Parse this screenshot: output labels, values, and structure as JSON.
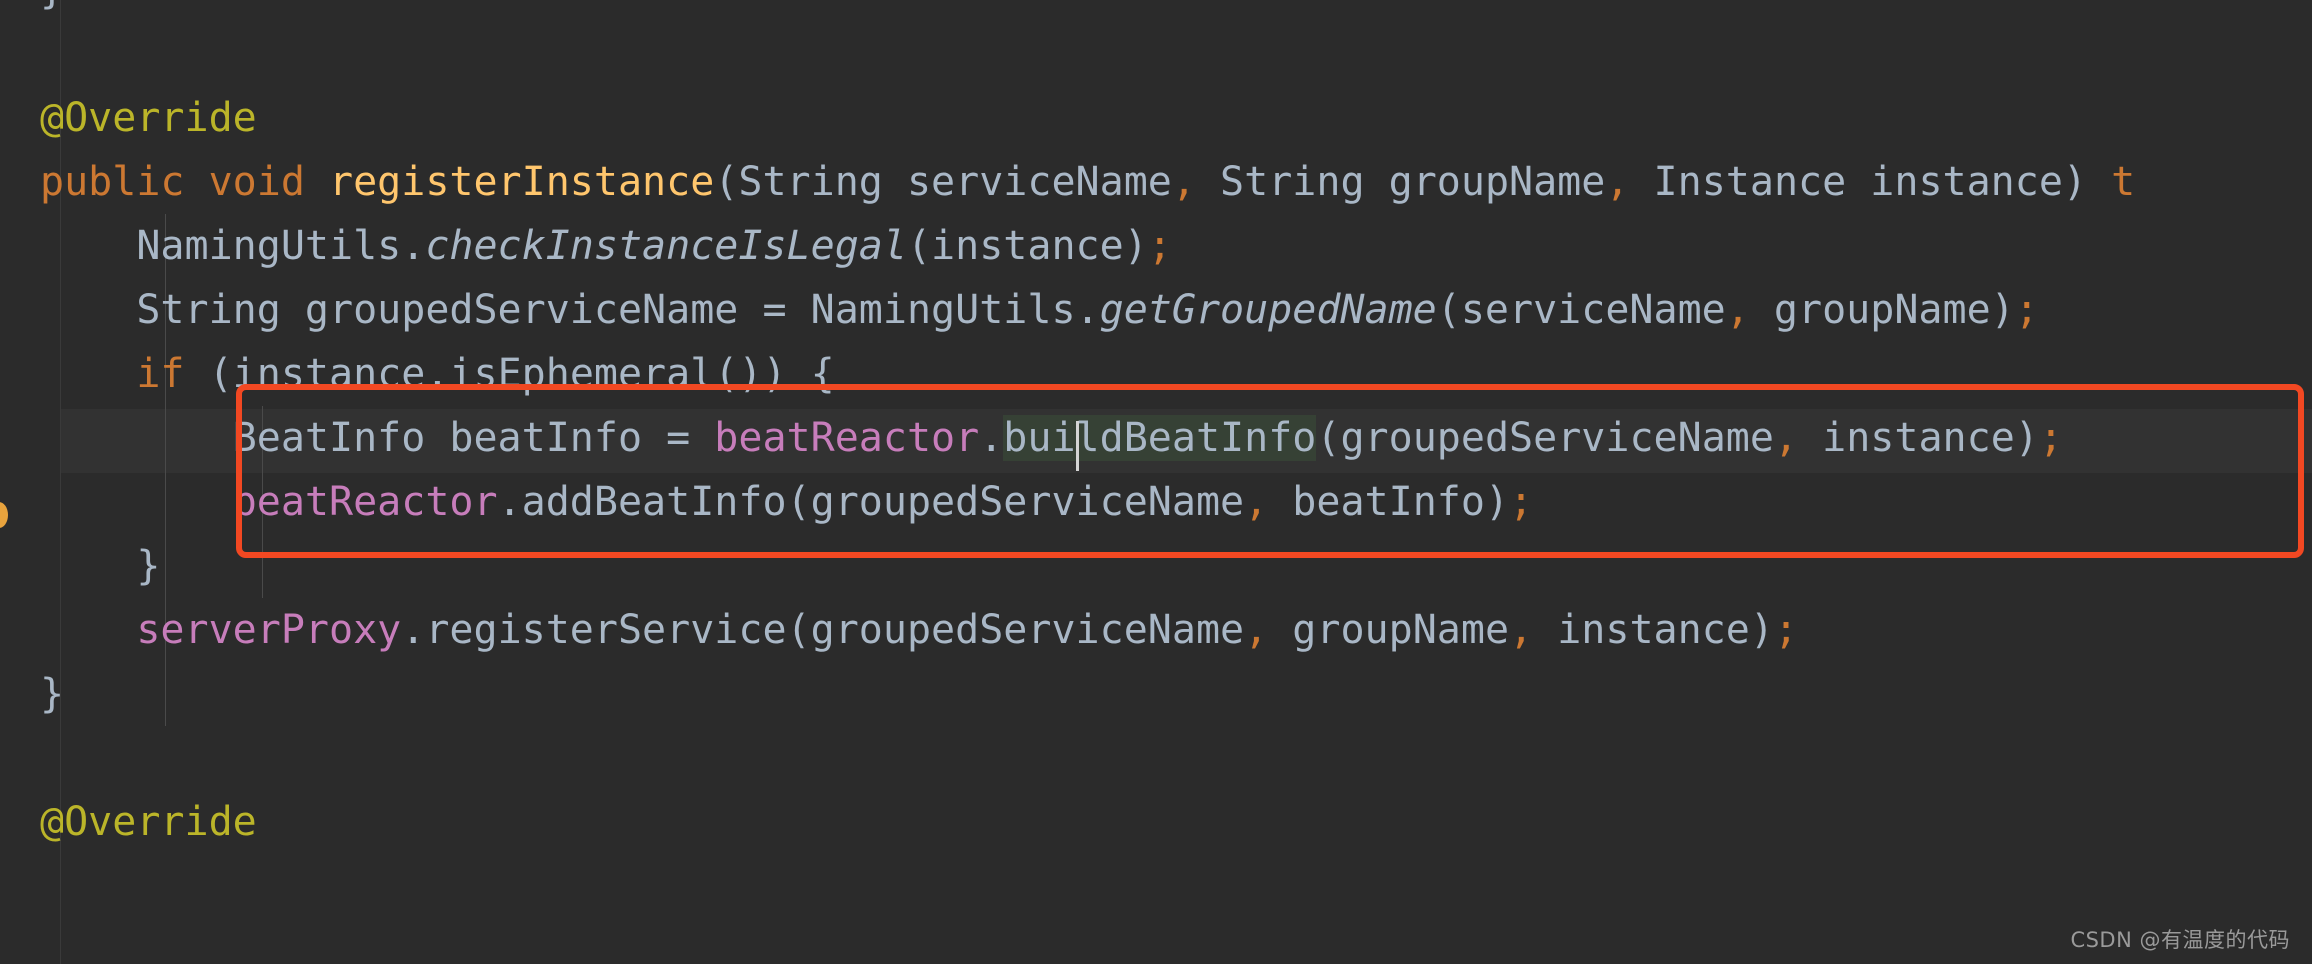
{
  "editor": {
    "theme_name": "darcula",
    "colors": {
      "background": "#2b2b2b",
      "current_line_background": "#323232",
      "gutter_separator": "#3a3a3a",
      "indent_guide": "#4a4a4a",
      "default_text": "#a9b7c6",
      "keyword": "#cc7832",
      "method_declaration": "#ffc66d",
      "field": "#c77dbb",
      "annotation": "#bbb529",
      "identifier_highlight": "#364135",
      "caret": "#d4d4d4",
      "annotation_box": "#f24822",
      "gutter_marker": "#e8a33d",
      "watermark": "#9a9a9a"
    },
    "caret": {
      "line_number": 6,
      "column_label": "bui|ldBeatInfo"
    },
    "highlighted_identifier": "buildBeatInfo"
  },
  "code_lines": [
    {
      "id": "line-1",
      "text": "}",
      "indent": 0,
      "tokens": [
        {
          "kind": "brace",
          "text": "}"
        }
      ]
    },
    {
      "id": "line-2",
      "text": "",
      "indent": 0,
      "tokens": []
    },
    {
      "id": "line-3",
      "text": "@Override",
      "indent": 0,
      "tokens": [
        {
          "kind": "annotation",
          "text": "@Override"
        }
      ]
    },
    {
      "id": "line-4",
      "text": "public void registerInstance(String serviceName, String groupName, Instance instance) t",
      "indent": 0,
      "tokens": [
        {
          "kind": "keyword",
          "text": "public void "
        },
        {
          "kind": "method",
          "text": "registerInstance"
        },
        {
          "kind": "default",
          "text": "(String serviceName"
        },
        {
          "kind": "comma",
          "text": ","
        },
        {
          "kind": "default",
          "text": " String groupName"
        },
        {
          "kind": "comma",
          "text": ","
        },
        {
          "kind": "default",
          "text": " Instance instance) "
        },
        {
          "kind": "keyword",
          "text": "t"
        }
      ]
    },
    {
      "id": "line-5",
      "text": "    NamingUtils.checkInstanceIsLegal(instance);",
      "indent": 1,
      "tokens": [
        {
          "kind": "default",
          "text": "    NamingUtils."
        },
        {
          "kind": "static",
          "text": "checkInstanceIsLegal"
        },
        {
          "kind": "default",
          "text": "(instance)"
        },
        {
          "kind": "semi",
          "text": ";"
        }
      ]
    },
    {
      "id": "line-6",
      "text": "    String groupedServiceName = NamingUtils.getGroupedName(serviceName, groupName);",
      "indent": 1,
      "tokens": [
        {
          "kind": "default",
          "text": "    String groupedServiceName = NamingUtils."
        },
        {
          "kind": "static",
          "text": "getGroupedName"
        },
        {
          "kind": "default",
          "text": "(serviceName"
        },
        {
          "kind": "comma",
          "text": ","
        },
        {
          "kind": "default",
          "text": " groupName)"
        },
        {
          "kind": "semi",
          "text": ";"
        }
      ]
    },
    {
      "id": "line-7",
      "text": "    if (instance.isEphemeral()) {",
      "indent": 1,
      "tokens": [
        {
          "kind": "default",
          "text": "    "
        },
        {
          "kind": "keyword",
          "text": "if"
        },
        {
          "kind": "default",
          "text": " (instance.isEphemeral()) {"
        }
      ]
    },
    {
      "id": "line-8",
      "text": "        BeatInfo beatInfo = beatReactor.buildBeatInfo(groupedServiceName, instance);",
      "indent": 2,
      "current_line": true,
      "tokens": [
        {
          "kind": "default",
          "text": "        BeatInfo beatInfo = "
        },
        {
          "kind": "field",
          "text": "beatReactor"
        },
        {
          "kind": "default",
          "text": "."
        },
        {
          "kind": "highlight",
          "text": "buildBeatInfo"
        },
        {
          "kind": "default",
          "text": "(groupedServiceName"
        },
        {
          "kind": "comma",
          "text": ","
        },
        {
          "kind": "default",
          "text": " instance)"
        },
        {
          "kind": "semi",
          "text": ";"
        }
      ]
    },
    {
      "id": "line-9",
      "text": "        beatReactor.addBeatInfo(groupedServiceName, beatInfo);",
      "indent": 2,
      "tokens": [
        {
          "kind": "default",
          "text": "        "
        },
        {
          "kind": "field",
          "text": "beatReactor"
        },
        {
          "kind": "default",
          "text": ".addBeatInfo(groupedServiceName"
        },
        {
          "kind": "comma",
          "text": ","
        },
        {
          "kind": "default",
          "text": " beatInfo)"
        },
        {
          "kind": "semi",
          "text": ";"
        }
      ]
    },
    {
      "id": "line-10",
      "text": "    }",
      "indent": 1,
      "tokens": [
        {
          "kind": "brace",
          "text": "    }"
        }
      ]
    },
    {
      "id": "line-11",
      "text": "    serverProxy.registerService(groupedServiceName, groupName, instance);",
      "indent": 1,
      "tokens": [
        {
          "kind": "default",
          "text": "    "
        },
        {
          "kind": "field",
          "text": "serverProxy"
        },
        {
          "kind": "default",
          "text": ".registerService(groupedServiceName"
        },
        {
          "kind": "comma",
          "text": ","
        },
        {
          "kind": "default",
          "text": " groupName"
        },
        {
          "kind": "comma",
          "text": ","
        },
        {
          "kind": "default",
          "text": " instance)"
        },
        {
          "kind": "semi",
          "text": ";"
        }
      ]
    },
    {
      "id": "line-12",
      "text": "}",
      "indent": 0,
      "tokens": [
        {
          "kind": "brace",
          "text": "}"
        }
      ]
    },
    {
      "id": "line-13",
      "text": "",
      "indent": 0,
      "tokens": []
    },
    {
      "id": "line-14",
      "text": "@Override",
      "indent": 0,
      "tokens": [
        {
          "kind": "annotation",
          "text": "@Override"
        }
      ]
    }
  ],
  "annotation_box": {
    "label": "red-highlight-rectangle",
    "covers_lines": [
      8,
      9
    ],
    "color": "#f24822",
    "border_width_px": 6
  },
  "watermark": {
    "text": "CSDN @有温度的代码"
  }
}
